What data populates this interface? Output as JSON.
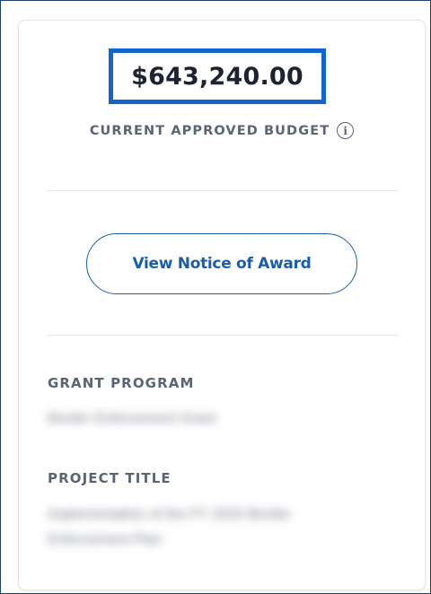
{
  "budget": {
    "amount": "$643,240.00",
    "label": "CURRENT APPROVED BUDGET",
    "info_icon": "info-icon"
  },
  "actions": {
    "view_award_label": "View Notice of Award"
  },
  "fields": {
    "grant_program": {
      "label": "GRANT PROGRAM",
      "value": "Border Enforcement Grant"
    },
    "project_title": {
      "label": "PROJECT TITLE",
      "value": "Implementation of the FY 2020 Border Enforcement Plan"
    }
  },
  "colors": {
    "highlight": "#1366c9",
    "accent": "#1a5ea8",
    "label": "#5b6473",
    "text": "#1d2330"
  }
}
